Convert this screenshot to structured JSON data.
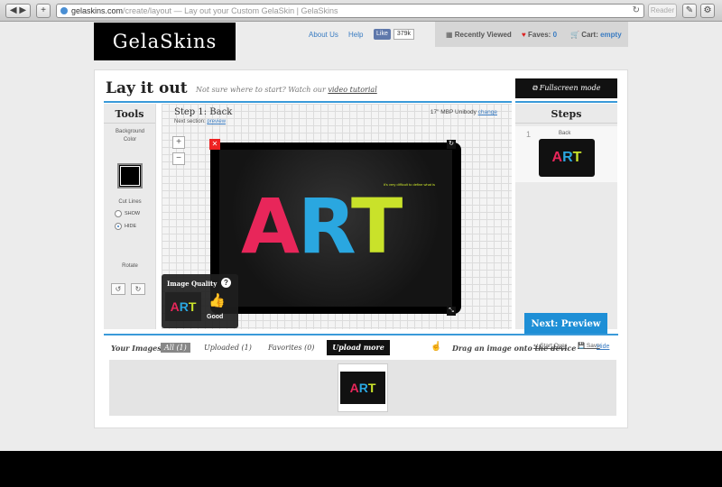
{
  "browser": {
    "url_host": "gelaskins.com",
    "url_path": "/create/layout",
    "page_title": " — Lay out your Custom GelaSkin | GelaSkins",
    "reader_label": "Reader",
    "reload_icon": "reload-icon"
  },
  "header": {
    "logo": "GelaSkins",
    "about": "About Us",
    "help": "Help",
    "like_label": "Like",
    "like_count": "379k",
    "recently_viewed": "Recently Viewed",
    "faves_label": "Faves:",
    "faves_count": "0",
    "cart_label": "Cart:",
    "cart_value": "empty"
  },
  "layout": {
    "title": "Lay it out",
    "hint": "Not sure where to start? Watch our",
    "hint_link": "video tutorial",
    "fullscreen": "Fullscreen mode"
  },
  "tools": {
    "title": "Tools",
    "bg_color_label": "Background Color",
    "cut_lines_label": "Cut Lines",
    "show_label": "SHOW",
    "hide_label": "HIDE",
    "rotate_label": "Rotate",
    "background_color": "#000000"
  },
  "canvas": {
    "step": "Step 1: Back",
    "next_section_label": "Next section:",
    "next_section_link": "preview",
    "model": "17\" MBP Unibody",
    "change_link": "change",
    "zoom_in": "+",
    "zoom_out": "−",
    "art_a": "A",
    "art_r": "R",
    "art_t": "T",
    "art_caption": "it's very difficult to define what is"
  },
  "quality": {
    "title": "Image Quality",
    "help": "?",
    "rating": "Good"
  },
  "steps": {
    "title": "Steps",
    "step_number": "1",
    "step_label": "Back",
    "next_button": "Next: Preview",
    "start_over": "Start Over",
    "save": "Save"
  },
  "images": {
    "label": "Your Images:",
    "all": "All (1)",
    "uploaded": "Uploaded (1)",
    "favorites": "Favorites (0)",
    "upload_button": "Upload more",
    "drag_text": "Drag an image onto the device",
    "hide": "Hide"
  }
}
